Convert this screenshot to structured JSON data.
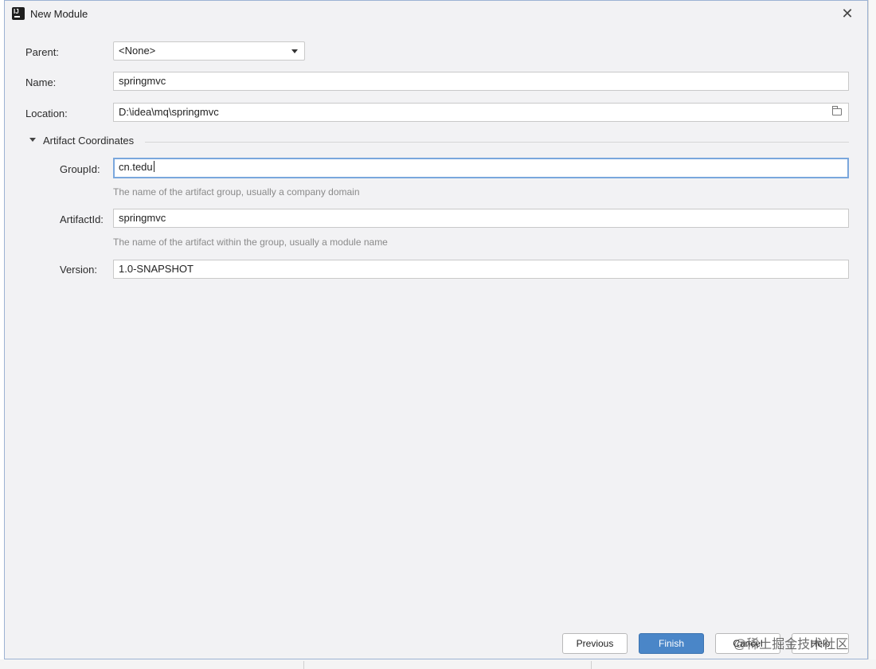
{
  "window": {
    "title": "New Module",
    "icon": "intellij-idea-icon",
    "close_icon": "close-icon"
  },
  "form": {
    "parent": {
      "label": "Parent:",
      "value": "<None>"
    },
    "name": {
      "label": "Name:",
      "value": "springmvc"
    },
    "location": {
      "label": "Location:",
      "value": "D:\\idea\\mq\\springmvc",
      "browse_icon": "folder-icon"
    }
  },
  "artifact": {
    "section_title": "Artifact Coordinates",
    "group_id": {
      "label": "GroupId:",
      "value": "cn.tedu",
      "hint": "The name of the artifact group, usually a company domain"
    },
    "artifact_id": {
      "label": "ArtifactId:",
      "value": "springmvc",
      "hint": "The name of the artifact within the group, usually a module name"
    },
    "version": {
      "label": "Version:",
      "value": "1.0-SNAPSHOT"
    }
  },
  "buttons": {
    "previous": "Previous",
    "finish": "Finish",
    "cancel": "Cancel",
    "help": "Help"
  },
  "watermark": "@稀土掘金技术社区",
  "colors": {
    "dialog_bg": "#f2f2f4",
    "accent": "#4a86c8",
    "focus_border": "#7aa7dd",
    "hint_text": "#8a8a8a"
  }
}
